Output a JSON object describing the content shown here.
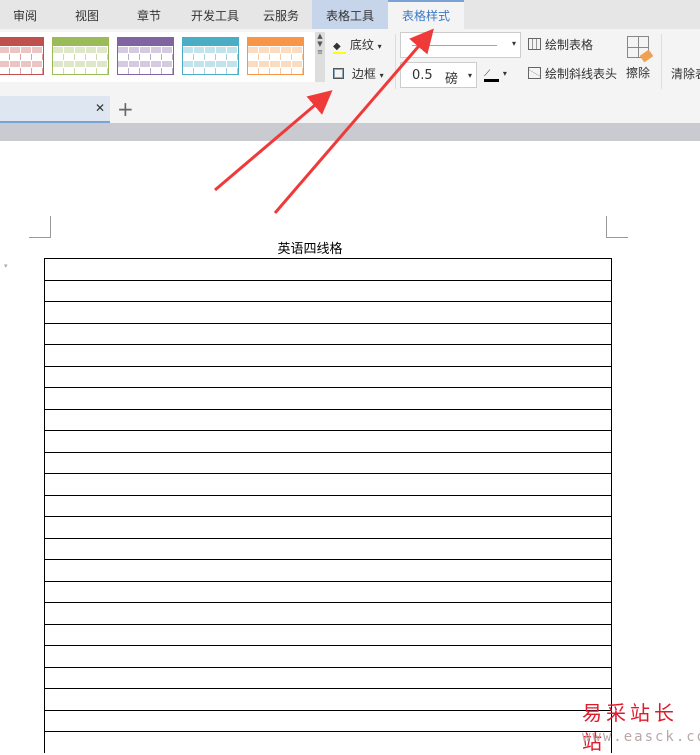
{
  "tabs": [
    {
      "label": "审阅"
    },
    {
      "label": "视图"
    },
    {
      "label": "章节"
    },
    {
      "label": "开发工具"
    },
    {
      "label": "云服务"
    },
    {
      "label": "表格工具"
    },
    {
      "label": "表格样式"
    }
  ],
  "active_tab": "表格样式",
  "ribbon": {
    "style_colors": [
      "#c0504d",
      "#9bbb59",
      "#8064a2",
      "#4bacc6",
      "#f79646"
    ],
    "shading_label": "底纹",
    "border_label": "边框",
    "line_width_value": "0.5",
    "line_width_unit": "磅",
    "draw_table_label": "绘制表格",
    "draw_diagonal_label": "绘制斜线表头",
    "erase_label": "擦除",
    "clear_label": "清除表"
  },
  "document": {
    "table_title": "英语四线格",
    "row_count": 23
  },
  "watermark": {
    "cn": "易采站长站",
    "url": "www.easck.com"
  }
}
